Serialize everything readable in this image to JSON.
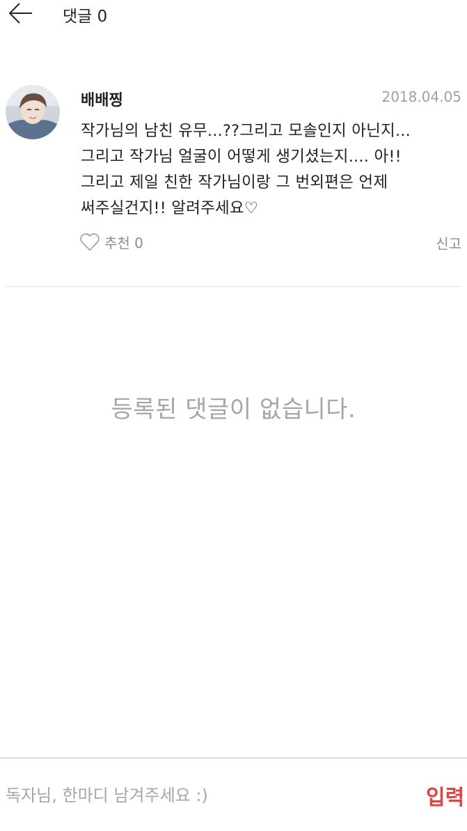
{
  "header": {
    "back_icon": "arrow-left-icon",
    "title": "댓글 0"
  },
  "comment": {
    "avatar_icon": "user-avatar",
    "author": "배배찡",
    "date": "2018.04.05",
    "lines": [
      "작가님의 남친 유무...??그리고 모솔인지 아닌지...",
      "그리고 작가님 얼굴이 어떻게 생기셨는지.... 아!!",
      "그리고 제일 친한 작가님이랑 그 번외편은 언제",
      "써주실건지!! 알려주세요♡"
    ],
    "like_icon": "heart-outline-icon",
    "like_label": "추천 0",
    "report_label": "신고"
  },
  "empty_message": "등록된 댓글이 없습니다.",
  "footer": {
    "input_placeholder": "독자님, 한마디 남겨주세요 :)",
    "input_value": "",
    "submit_label": "입력"
  },
  "colors": {
    "accent": "#e8413c",
    "muted_text": "#a6a6a6",
    "divider": "#e3e3e3"
  }
}
